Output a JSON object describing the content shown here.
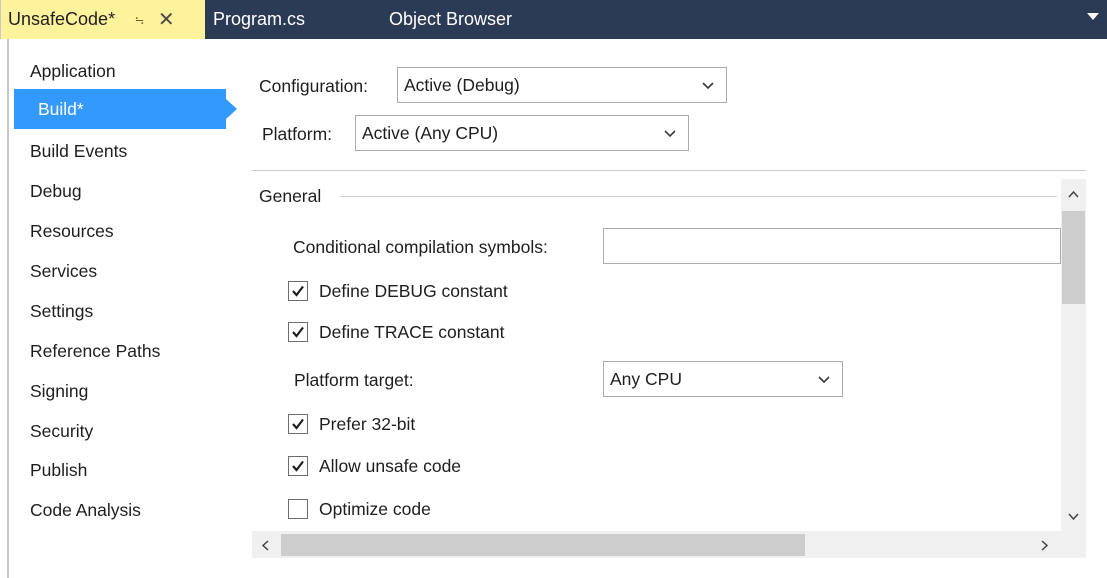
{
  "tabs": {
    "active": {
      "label": "UnsafeCode*",
      "pin_icon": "pin-icon",
      "close_icon": "close-icon",
      "color": "#fff29d"
    },
    "inactive": [
      {
        "label": "Program.cs"
      },
      {
        "label": "Object Browser"
      }
    ],
    "strip_color": "#2b3a55"
  },
  "sidebar": {
    "items": [
      {
        "label": "Application"
      },
      {
        "label": "Build*",
        "selected": true
      },
      {
        "label": "Build Events"
      },
      {
        "label": "Debug"
      },
      {
        "label": "Resources"
      },
      {
        "label": "Services"
      },
      {
        "label": "Settings"
      },
      {
        "label": "Reference Paths"
      },
      {
        "label": "Signing"
      },
      {
        "label": "Security"
      },
      {
        "label": "Publish"
      },
      {
        "label": "Code Analysis"
      }
    ],
    "selected_color": "#3399ff"
  },
  "config": {
    "configuration_label": "Configuration:",
    "configuration_value": "Active (Debug)",
    "platform_label": "Platform:",
    "platform_value": "Active (Any CPU)"
  },
  "general": {
    "title": "General",
    "conditional_symbols_label": "Conditional compilation symbols:",
    "conditional_symbols_value": "",
    "define_debug": {
      "label": "Define DEBUG constant",
      "checked": true
    },
    "define_trace": {
      "label": "Define TRACE constant",
      "checked": true
    },
    "platform_target_label": "Platform target:",
    "platform_target_value": "Any CPU",
    "prefer_32bit": {
      "label": "Prefer 32-bit",
      "checked": true
    },
    "allow_unsafe": {
      "label": "Allow unsafe code",
      "checked": true
    },
    "optimize_code": {
      "label": "Optimize code",
      "checked": false
    }
  },
  "scroll": {
    "up_arrow": "^",
    "down_arrow": "v",
    "left_arrow": "<",
    "right_arrow": ">"
  }
}
